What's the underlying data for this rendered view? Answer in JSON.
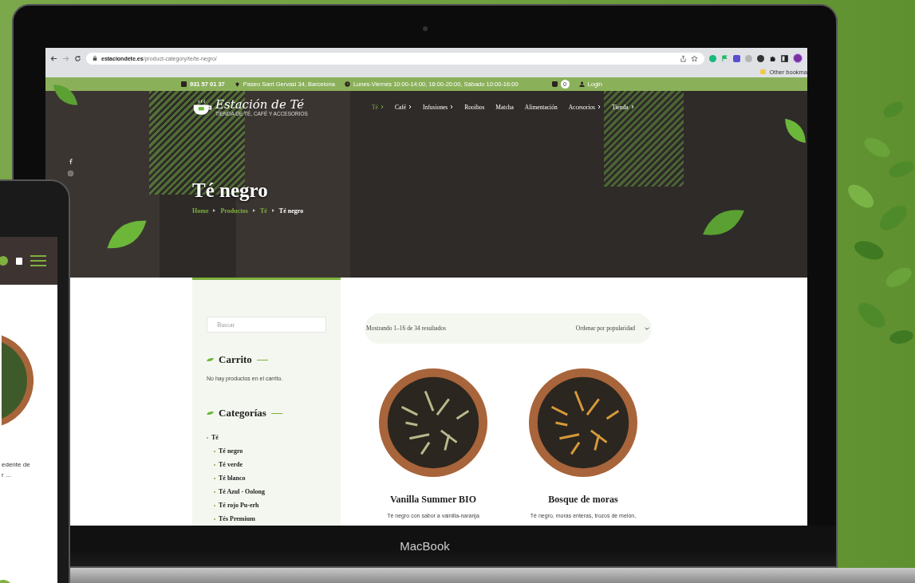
{
  "browser": {
    "url_domain": "estaciondete.es",
    "url_path": "/product-category/te/te-negro/",
    "bookmark": "Other bookma"
  },
  "topbar": {
    "phone": "931 57 01 37",
    "address": "Paseo Sant Gervasi 34, Barcelona",
    "hours": "Lunes-Viernes 10:00-14:00, 16:00-20:00, Sábado 10:00-16:00",
    "cart_count": "0",
    "login": "Login"
  },
  "logo": {
    "name": "Estación de Té",
    "tagline": "TIENDA DE TÉ, CAFÉ Y ACCESORIOS"
  },
  "nav": [
    {
      "label": "Té",
      "submenu": true,
      "selected": true
    },
    {
      "label": "Café",
      "submenu": true,
      "selected": false
    },
    {
      "label": "Infusiones",
      "submenu": true,
      "selected": false
    },
    {
      "label": "Rooibos",
      "submenu": false,
      "selected": false
    },
    {
      "label": "Matcha",
      "submenu": false,
      "selected": false
    },
    {
      "label": "Alimentación",
      "submenu": false,
      "selected": false
    },
    {
      "label": "Accesorios",
      "submenu": true,
      "selected": false
    },
    {
      "label": "Tienda",
      "submenu": true,
      "selected": false
    }
  ],
  "hero": {
    "title": "Té negro",
    "breadcrumb": [
      {
        "label": "Home",
        "current": false
      },
      {
        "label": "Productos",
        "current": false
      },
      {
        "label": "Té",
        "current": false
      },
      {
        "label": "Té negro",
        "current": true
      }
    ]
  },
  "sidebar": {
    "search": {
      "placeholder": "Buscar"
    },
    "cart_title": "Carrito",
    "cart_empty": "No hay productos en el carrito.",
    "categories_title": "Categorías",
    "categories": [
      {
        "label": "Té",
        "children": [
          {
            "label": "Té negro"
          },
          {
            "label": "Té verde"
          },
          {
            "label": "Té blanco"
          },
          {
            "label": "Té Azul - Oolong"
          },
          {
            "label": "Té rojo Pu-erh"
          },
          {
            "label": "Tés Premium"
          }
        ]
      }
    ]
  },
  "results": {
    "count": "Mostrando 1–16 de 34 resultados",
    "sort": "Ordenar por popularidad"
  },
  "products": [
    {
      "name": "Vanilla Summer BIO",
      "description": "Té negro con sabor a vainilla-naranja",
      "color": "#b7b98a"
    },
    {
      "name": "Bosque de moras",
      "description": "Té negro, moras enteras, trozos de melón,",
      "color": "#d69a3a"
    }
  ],
  "laptop": {
    "brand": "MacBook"
  },
  "phone": {
    "text_lines": [
      "edente de",
      "r ..."
    ]
  }
}
